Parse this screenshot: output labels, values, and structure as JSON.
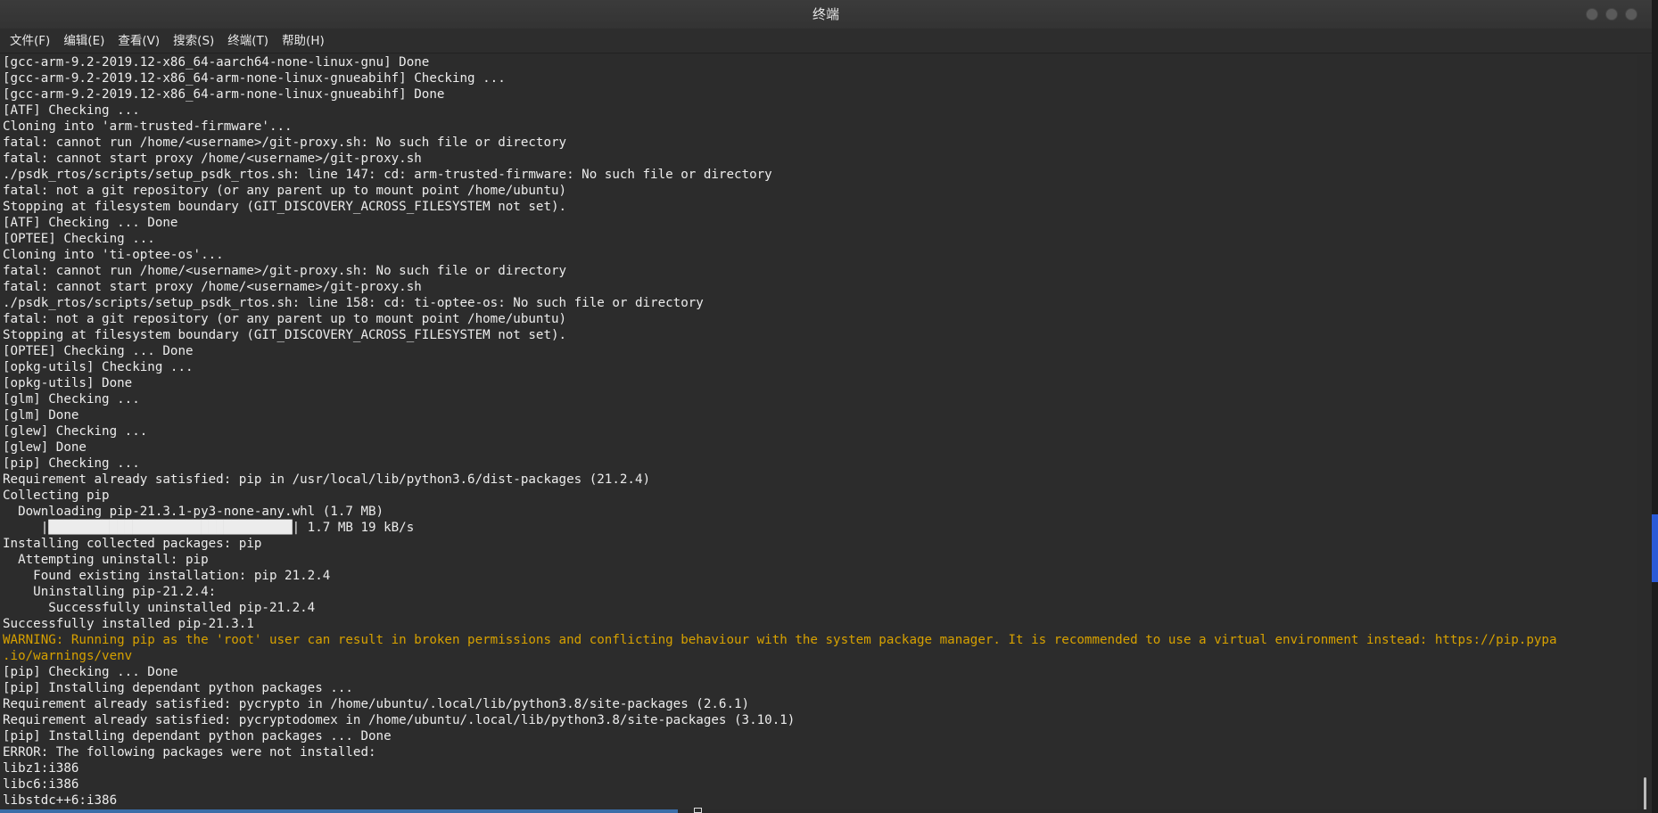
{
  "window": {
    "title": "终端"
  },
  "menu": [
    "文件(F)",
    "编辑(E)",
    "查看(V)",
    "搜索(S)",
    "终端(T)",
    "帮助(H)"
  ],
  "terminal": {
    "lines": [
      {
        "text": "[gcc-arm-9.2-2019.12-x86_64-aarch64-none-linux-gnu] Done",
        "type": "normal"
      },
      {
        "text": "[gcc-arm-9.2-2019.12-x86_64-arm-none-linux-gnueabihf] Checking ...",
        "type": "normal"
      },
      {
        "text": "[gcc-arm-9.2-2019.12-x86_64-arm-none-linux-gnueabihf] Done",
        "type": "normal"
      },
      {
        "text": "[ATF] Checking ...",
        "type": "normal"
      },
      {
        "text": "Cloning into 'arm-trusted-firmware'...",
        "type": "normal"
      },
      {
        "text": "fatal: cannot run /home/<username>/git-proxy.sh: No such file or directory",
        "type": "normal"
      },
      {
        "text": "fatal: cannot start proxy /home/<username>/git-proxy.sh",
        "type": "normal"
      },
      {
        "text": "./psdk_rtos/scripts/setup_psdk_rtos.sh: line 147: cd: arm-trusted-firmware: No such file or directory",
        "type": "normal"
      },
      {
        "text": "fatal: not a git repository (or any parent up to mount point /home/ubuntu)",
        "type": "normal"
      },
      {
        "text": "Stopping at filesystem boundary (GIT_DISCOVERY_ACROSS_FILESYSTEM not set).",
        "type": "normal"
      },
      {
        "text": "[ATF] Checking ... Done",
        "type": "normal"
      },
      {
        "text": "[OPTEE] Checking ...",
        "type": "normal"
      },
      {
        "text": "Cloning into 'ti-optee-os'...",
        "type": "normal"
      },
      {
        "text": "fatal: cannot run /home/<username>/git-proxy.sh: No such file or directory",
        "type": "normal"
      },
      {
        "text": "fatal: cannot start proxy /home/<username>/git-proxy.sh",
        "type": "normal"
      },
      {
        "text": "./psdk_rtos/scripts/setup_psdk_rtos.sh: line 158: cd: ti-optee-os: No such file or directory",
        "type": "normal"
      },
      {
        "text": "fatal: not a git repository (or any parent up to mount point /home/ubuntu)",
        "type": "normal"
      },
      {
        "text": "Stopping at filesystem boundary (GIT_DISCOVERY_ACROSS_FILESYSTEM not set).",
        "type": "normal"
      },
      {
        "text": "[OPTEE] Checking ... Done",
        "type": "normal"
      },
      {
        "text": "[opkg-utils] Checking ...",
        "type": "normal"
      },
      {
        "text": "[opkg-utils] Done",
        "type": "normal"
      },
      {
        "text": "[glm] Checking ...",
        "type": "normal"
      },
      {
        "text": "[glm] Done",
        "type": "normal"
      },
      {
        "text": "[glew] Checking ...",
        "type": "normal"
      },
      {
        "text": "[glew] Done",
        "type": "normal"
      },
      {
        "text": "[pip] Checking ...",
        "type": "normal"
      },
      {
        "text": "Requirement already satisfied: pip in /usr/local/lib/python3.6/dist-packages (21.2.4)",
        "type": "normal"
      },
      {
        "text": "Collecting pip",
        "type": "normal"
      },
      {
        "text": "  Downloading pip-21.3.1-py3-none-any.whl (1.7 MB)",
        "type": "normal"
      },
      {
        "text": "     |████████████████████████████████| 1.7 MB 19 kB/s",
        "type": "normal"
      },
      {
        "text": "Installing collected packages: pip",
        "type": "normal"
      },
      {
        "text": "  Attempting uninstall: pip",
        "type": "normal"
      },
      {
        "text": "    Found existing installation: pip 21.2.4",
        "type": "normal"
      },
      {
        "text": "    Uninstalling pip-21.2.4:",
        "type": "normal"
      },
      {
        "text": "      Successfully uninstalled pip-21.2.4",
        "type": "normal"
      },
      {
        "text": "Successfully installed pip-21.3.1",
        "type": "normal"
      },
      {
        "text": "WARNING: Running pip as the 'root' user can result in broken permissions and conflicting behaviour with the system package manager. It is recommended to use a virtual environment instead: https://pip.pypa",
        "type": "warn"
      },
      {
        "text": ".io/warnings/venv",
        "type": "warn"
      },
      {
        "text": "[pip] Checking ... Done",
        "type": "normal"
      },
      {
        "text": "[pip] Installing dependant python packages ...",
        "type": "normal"
      },
      {
        "text": "Requirement already satisfied: pycrypto in /home/ubuntu/.local/lib/python3.8/site-packages (2.6.1)",
        "type": "normal"
      },
      {
        "text": "Requirement already satisfied: pycryptodomex in /home/ubuntu/.local/lib/python3.8/site-packages (3.10.1)",
        "type": "normal"
      },
      {
        "text": "[pip] Installing dependant python packages ... Done",
        "type": "normal"
      },
      {
        "text": "ERROR: The following packages were not installed:",
        "type": "normal"
      },
      {
        "text": "libz1:i386",
        "type": "normal"
      },
      {
        "text": "libc6:i386",
        "type": "normal"
      },
      {
        "text": "libstdc++6:i386",
        "type": "normal"
      }
    ]
  },
  "colors": {
    "background": "#2c2c2c",
    "text": "#ececec",
    "warning": "#d7a100",
    "accent": "#2a5ad8"
  }
}
